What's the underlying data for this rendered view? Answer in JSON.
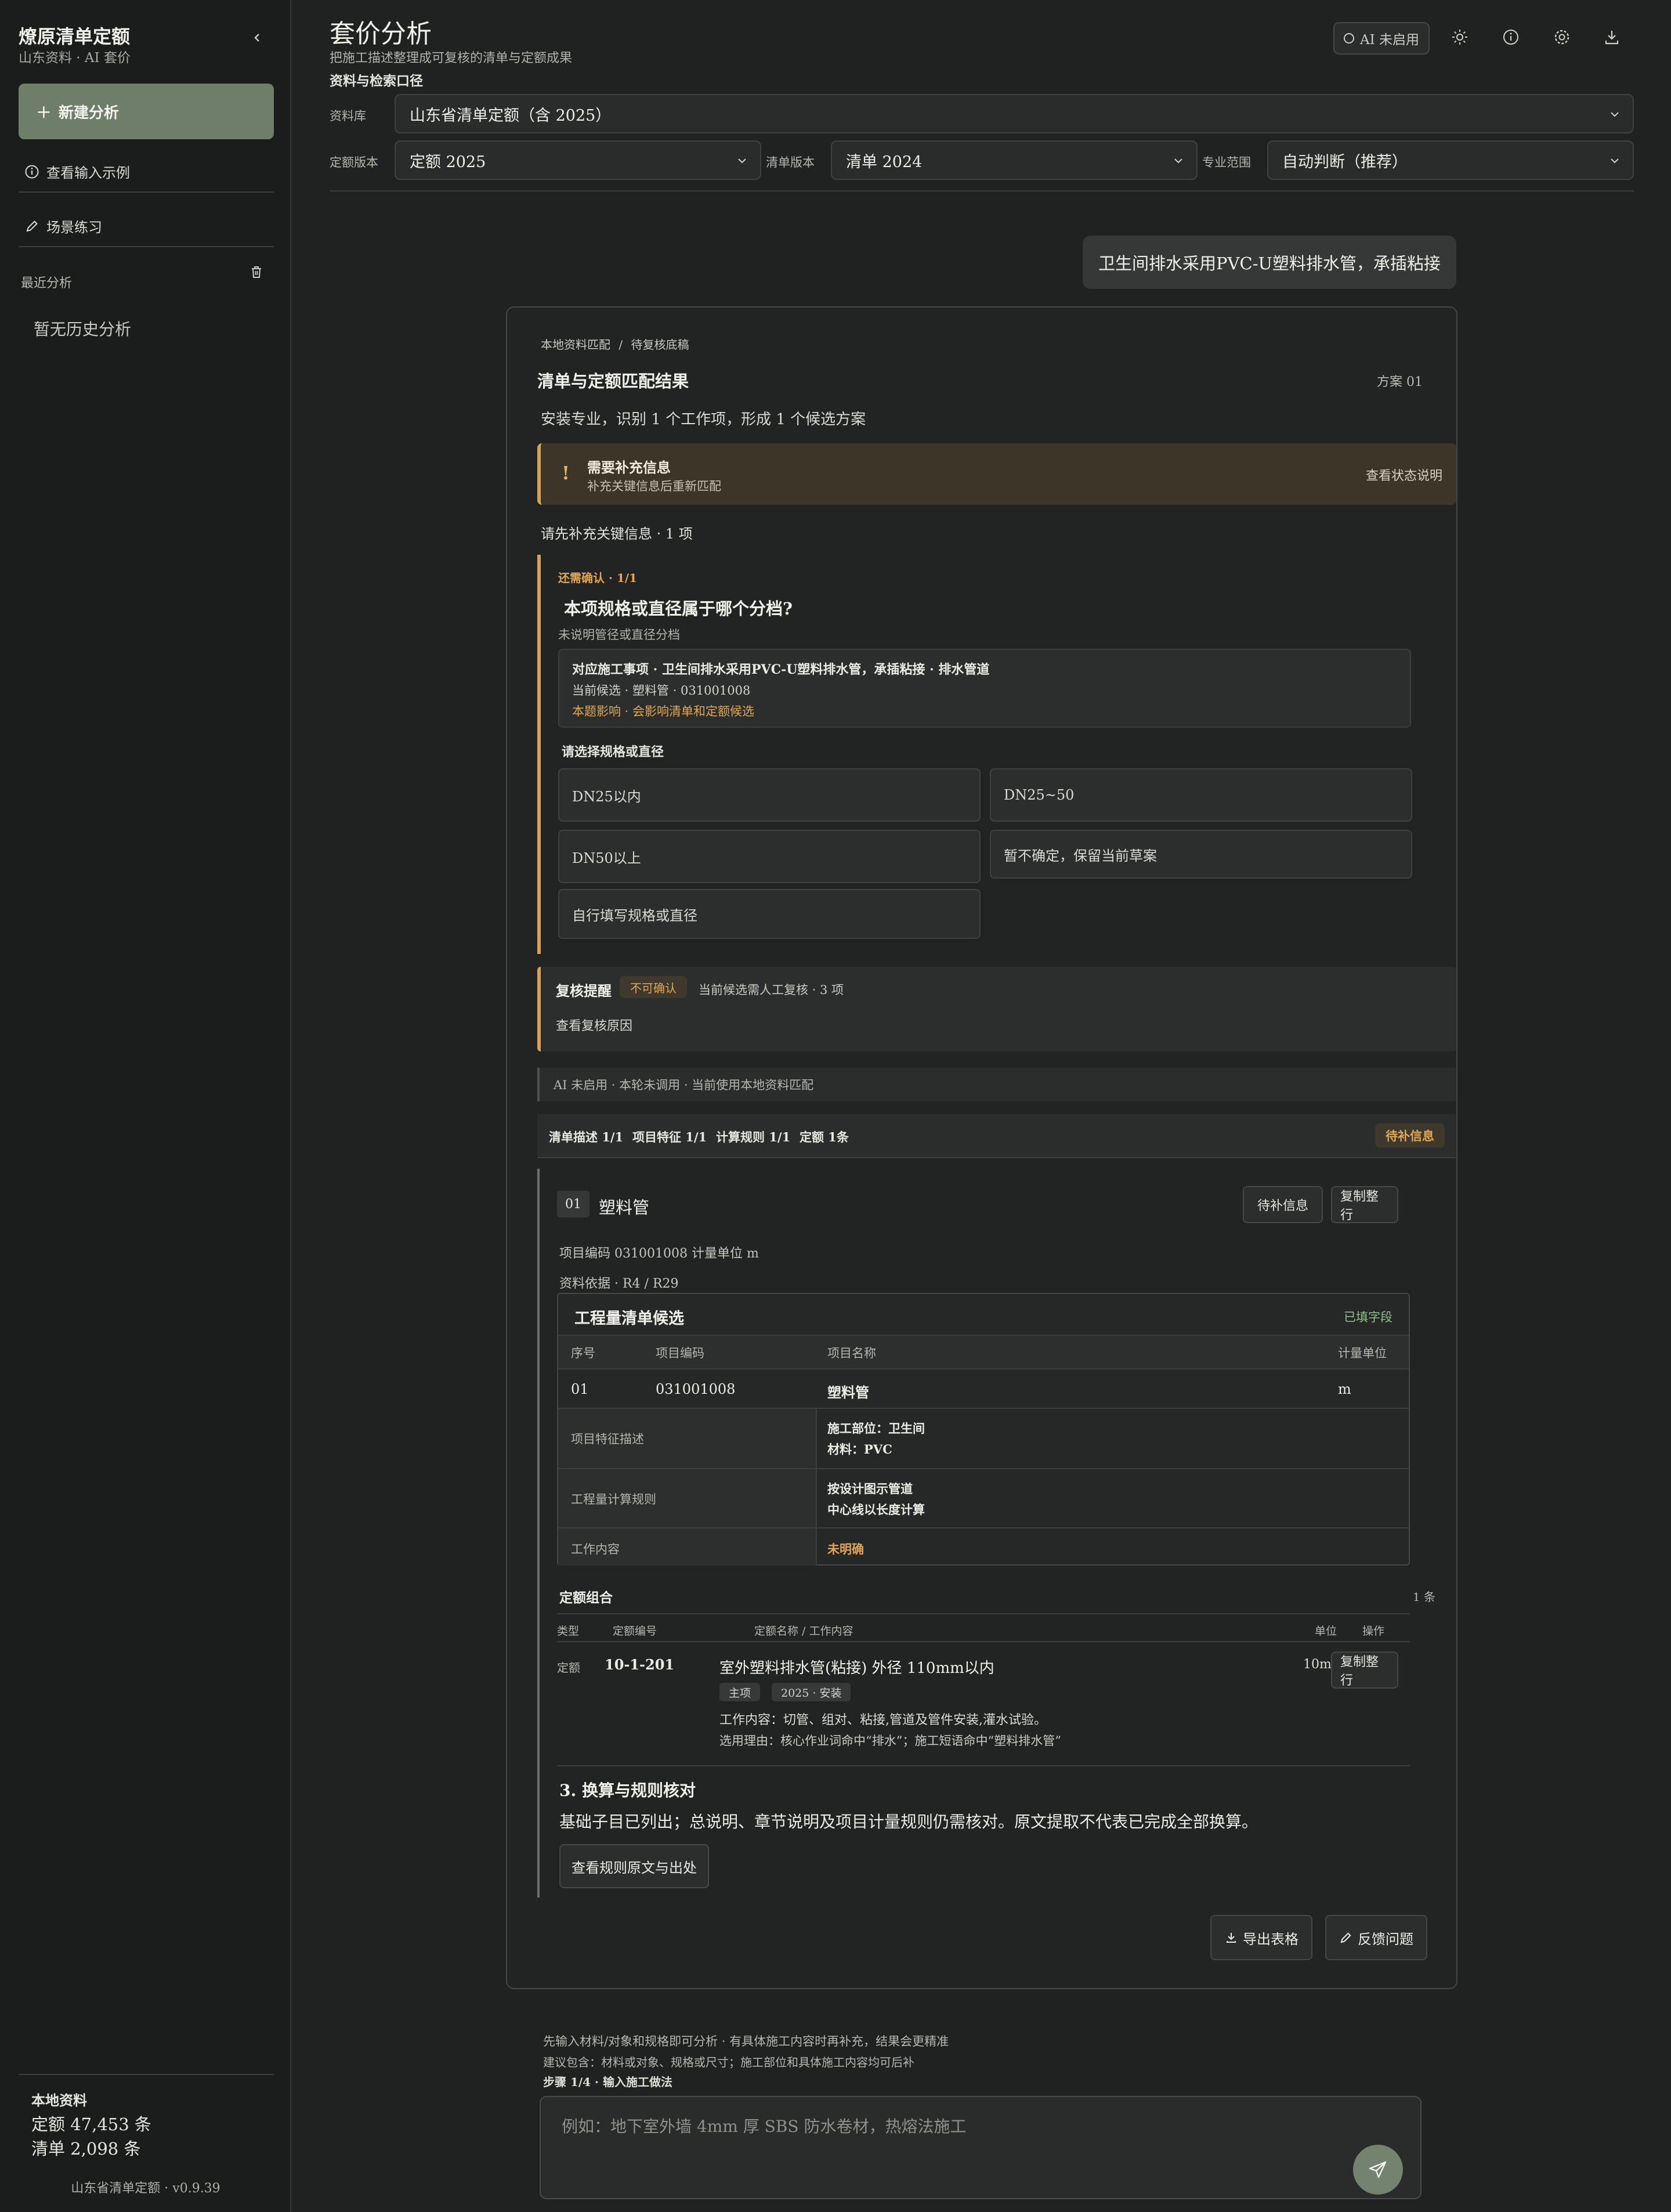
{
  "sidebar": {
    "app_title": "燎原清单定额",
    "app_subtitle": "山东资料 · AI 套价",
    "new_button": "新建分析",
    "view_examples": "查看输入示例",
    "scene_practice": "场景练习",
    "recent_heading": "最近分析",
    "empty_history": "暂无历史分析",
    "local_heading": "本地资料",
    "quota_count": "定额 47,453 条",
    "list_count": "清单 2,098 条",
    "version": "山东省清单定额 · v0.9.39"
  },
  "header": {
    "title": "套价分析",
    "subtitle": "把施工描述整理成可复核的清单与定额成果",
    "section": "资料与检索口径",
    "ai_status": "AI 未启用"
  },
  "filters": {
    "library_label": "资料库",
    "library_value": "山东省清单定额（含 2025）",
    "quota_label": "定额版本",
    "quota_value": "定额 2025",
    "list_label": "清单版本",
    "list_value": "清单 2024",
    "scope_label": "专业范围",
    "scope_value": "自动判断（推荐）"
  },
  "user_message": "卫生间排水采用PVC-U塑料排水管，承插粘接",
  "result": {
    "breadcrumb_1": "本地资料匹配",
    "breadcrumb_sep": "/",
    "breadcrumb_2": "待复核底稿",
    "title": "清单与定额匹配结果",
    "plan_no": "方案 01",
    "description": "安装专业，识别 1 个工作项，形成 1 个候选方案",
    "warning": {
      "icon": "!",
      "title": "需要补充信息",
      "sub": "补充关键信息后重新匹配",
      "link": "查看状态说明"
    },
    "need_info": "请先补充关键信息 · 1 项",
    "confirm": {
      "tag": "还需确认 · 1/1",
      "question": "本项规格或直径属于哪个分档?",
      "sub": "未说明管径或直径分档",
      "info_line1": "对应施工事项 · 卫生间排水采用PVC-U塑料排水管，承插粘接 · 排水管道",
      "info_line2": "当前候选 · 塑料管 · 031001008",
      "info_line3": "本题影响 · 会影响清单和定额候选",
      "pick_label": "请选择规格或直径",
      "options": [
        "DN25以内",
        "DN25~50",
        "DN50以上",
        "暂不确定，保留当前草案",
        "自行填写规格或直径"
      ]
    },
    "review": {
      "title": "复核提醒",
      "badge": "不可确认",
      "desc": "当前候选需人工复核 · 3 项",
      "link": "查看复核原因"
    },
    "ai_line": "AI 未启用 · 本轮未调用 · 当前使用本地资料匹配",
    "stats": {
      "desc": "清单描述 1/1",
      "feature": "项目特征 1/1",
      "rule": "计算规则 1/1",
      "quota": "定额 1条",
      "status": "待补信息"
    },
    "item": {
      "num": "01",
      "name": "塑料管",
      "status_btn": "待补信息",
      "copy_btn": "复制整行",
      "meta1": "项目编码 031001008  计量单位 m",
      "meta2": "资料依据 · R4 / R29",
      "candidates": {
        "title": "工程量清单候选",
        "done": "已填字段",
        "headers": [
          "序号",
          "项目编码",
          "项目名称",
          "计量单位"
        ],
        "row": [
          "01",
          "031001008",
          "塑料管",
          "m"
        ],
        "feature_label": "项目特征描述",
        "feature_value_1": "施工部位：卫生间",
        "feature_value_2": "材料：PVC",
        "rule_label": "工程量计算规则",
        "rule_value_1": "按设计图示管道",
        "rule_value_2": "中心线以长度计算",
        "work_label": "工作内容",
        "work_value": "未明确"
      },
      "quota": {
        "title": "定额组合",
        "count": "1 条",
        "headers": [
          "类型",
          "定额编号",
          "定额名称 / 工作内容",
          "单位",
          "操作"
        ],
        "type": "定额",
        "code": "10-1-201",
        "name": "室外塑料排水管(粘接) 外径 110mm以内",
        "tag_1": "主项",
        "tag_2": "2025 · 安装",
        "work": "工作内容：切管、组对、粘接,管道及管件安装,灌水试验。",
        "reason": "选用理由：核心作业词命中“排水”；施工短语命中“塑料排水管”",
        "unit": "10m",
        "copy_btn": "复制整行"
      },
      "section3_title": "3. 换算与规则核对",
      "section3_desc": "基础子目已列出；总说明、章节说明及项目计量规则仍需核对。原文提取不代表已完成全部换算。",
      "rule_btn": "查看规则原文与出处"
    },
    "export_btn": "导出表格",
    "feedback_btn": "反馈问题"
  },
  "composer": {
    "hint_1": "先输入材料/对象和规格即可分析 · 有具体施工内容时再补充，结果会更精准",
    "hint_2": "建议包含：材料或对象、规格或尺寸；施工部位和具体施工内容均可后补",
    "step": "步骤 1/4 · 输入施工做法",
    "placeholder": "例如：地下室外墙 4mm 厚 SBS 防水卷材，热熔法施工"
  },
  "colors": {
    "accent": "#6e7e6a",
    "warning": "#e0a653",
    "success": "#8fbf8c"
  }
}
